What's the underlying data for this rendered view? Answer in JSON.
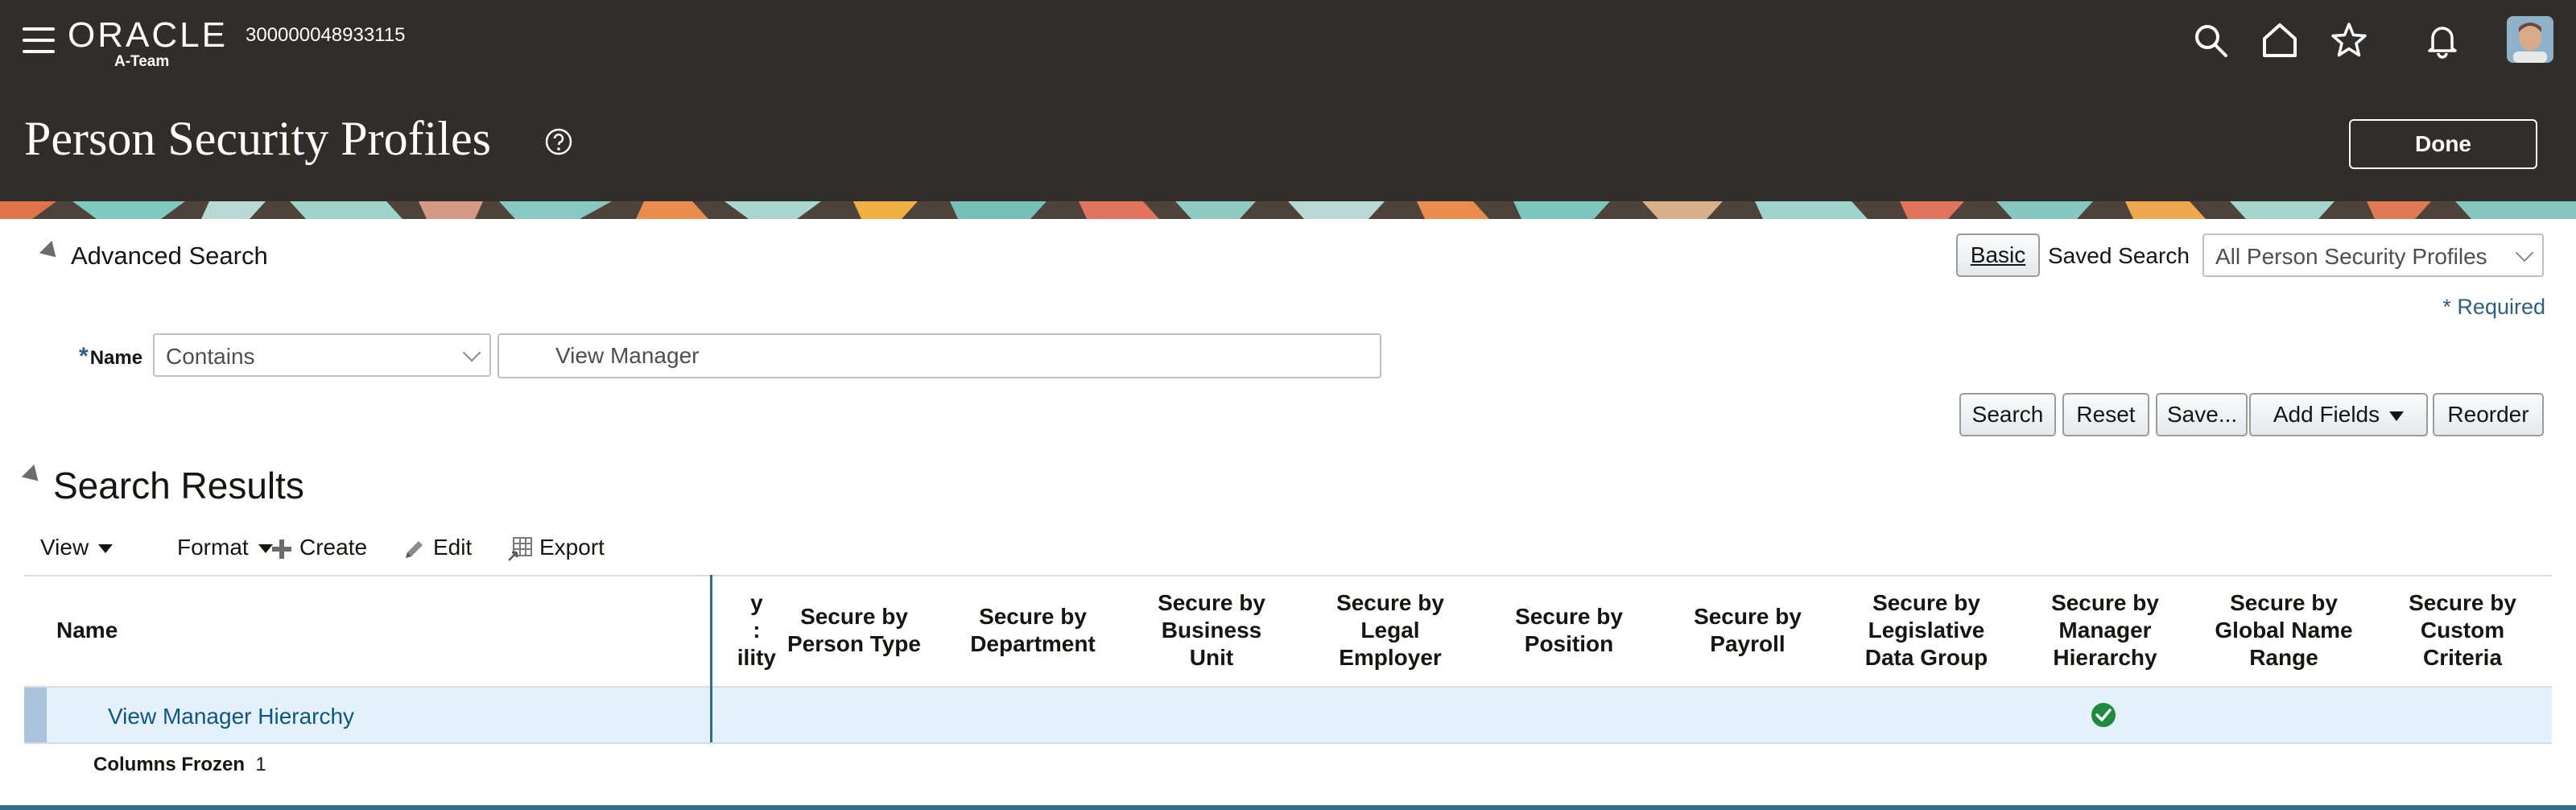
{
  "header": {
    "logo_text": "ORACLE",
    "logo_subtext": "A-Team",
    "instance_id": "300000048933115",
    "page_title": "Person Security Profiles",
    "done_label": "Done",
    "icons": [
      "search-icon",
      "home-icon",
      "star-icon",
      "bell-icon"
    ]
  },
  "search": {
    "title": "Advanced Search",
    "basic_label": "Basic",
    "saved_search_label": "Saved Search",
    "saved_search_value": "All Person Security Profiles",
    "required_note": "* Required",
    "name_label": "Name",
    "name_required_star": "*",
    "operator_value": "Contains",
    "name_value": "View Manager",
    "buttons": {
      "search": "Search",
      "reset": "Reset",
      "save": "Save...",
      "add_fields": "Add Fields",
      "reorder": "Reorder"
    }
  },
  "results": {
    "title": "Search Results",
    "toolbar": {
      "view": "View",
      "format": "Format",
      "create": "Create",
      "edit": "Edit",
      "export": "Export"
    },
    "columns": {
      "name": "Name",
      "partial": "y\n:\nility",
      "person_type": "Secure by Person Type",
      "department": "Secure by Department",
      "business_unit": "Secure by Business Unit",
      "legal_employer": "Secure by Legal Employer",
      "position": "Secure by Position",
      "payroll": "Secure by Payroll",
      "legislative": "Secure by Legislative Data Group",
      "manager_hierarchy": "Secure by Manager Hierarchy",
      "global_name": "Secure by Global Name Range",
      "custom": "Secure by Custom Criteria"
    },
    "rows": [
      {
        "name": "View Manager Hierarchy",
        "secure_by_manager_hierarchy": true
      }
    ],
    "columns_frozen_label": "Columns Frozen",
    "columns_frozen_value": "1"
  },
  "colors": {
    "header_bg": "#312d2a",
    "link": "#0e5683",
    "required": "#2c5f83",
    "selected_row": "#e4f0fa",
    "check": "#1f8a3b"
  }
}
